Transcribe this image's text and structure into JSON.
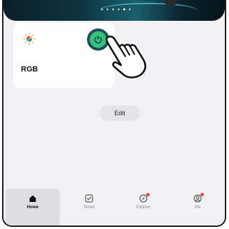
{
  "device": {
    "name": "RGB",
    "icon": "rgb-light-icon",
    "power_state": "on",
    "power_color": "#35c27a"
  },
  "edit_label": "Edit",
  "tabs": [
    {
      "label": "Home",
      "icon": "home-icon",
      "active": true,
      "badge": false
    },
    {
      "label": "Smart",
      "icon": "smart-checkbox-icon",
      "active": false,
      "badge": false
    },
    {
      "label": "Explore",
      "icon": "explore-compass-icon",
      "active": false,
      "badge": true
    },
    {
      "label": "Me",
      "icon": "profile-icon",
      "active": false,
      "badge": true
    }
  ],
  "colors": {
    "accent": "#35c27a",
    "badge": "#e8453c",
    "background": "#f2f2f4"
  }
}
